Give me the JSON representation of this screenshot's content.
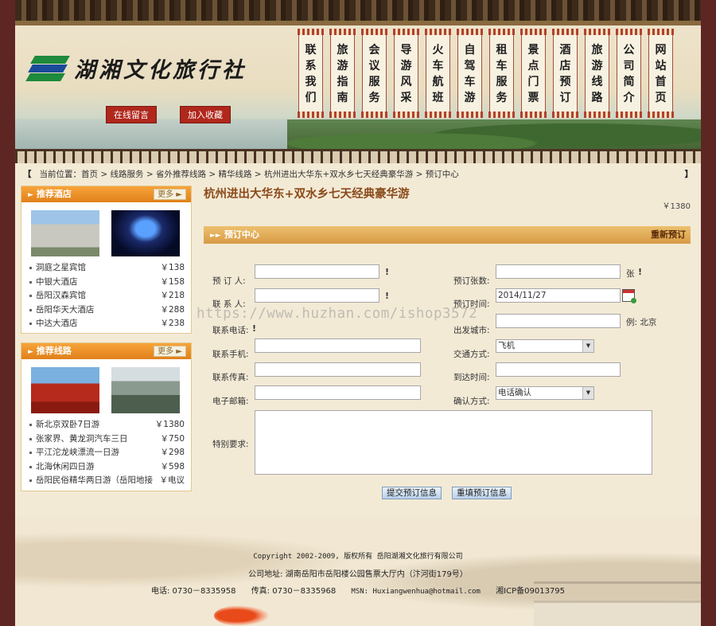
{
  "header": {
    "logo_text": "湖湘文化旅行社",
    "buttons": {
      "message": "在线留言",
      "favorite": "加入收藏"
    },
    "nav": [
      "联系我们",
      "旅游指南",
      "会议服务",
      "导游风采",
      "火车航班",
      "自驾车游",
      "租车服务",
      "景点门票",
      "酒店预订",
      "旅游线路",
      "公司简介",
      "网站首页"
    ]
  },
  "breadcrumb": {
    "prefix": "当前位置：",
    "items": [
      "首页",
      "线路服务",
      "省外推荐线路",
      "精华线路",
      "杭州进出大华东+双水乡七天经典豪华游",
      "预订中心"
    ],
    "sep": " > ",
    "bracket_left": "【",
    "bracket_right": "】"
  },
  "hotels": {
    "title": "推荐酒店",
    "more": "更多",
    "items": [
      {
        "name": "洞庭之星宾馆",
        "price": "￥138"
      },
      {
        "name": "中银大酒店",
        "price": "￥158"
      },
      {
        "name": "岳阳汉森宾馆",
        "price": "￥218"
      },
      {
        "name": "岳阳华天大酒店",
        "price": "￥288"
      },
      {
        "name": "中达大酒店",
        "price": "￥238"
      }
    ]
  },
  "routes": {
    "title": "推荐线路",
    "more": "更多",
    "items": [
      {
        "name": "新北京双卧7日游",
        "price": "￥1380"
      },
      {
        "name": "张家界、黄龙洞汽车三日",
        "price": "￥750"
      },
      {
        "name": "平江沱龙峡漂流一日游",
        "price": "￥298"
      },
      {
        "name": "北海休闲四日游",
        "price": "￥598"
      },
      {
        "name": "岳阳民俗精华两日游（岳阳地接",
        "price": "￥电议"
      }
    ]
  },
  "main": {
    "title": "杭州进出大华东+双水乡七天经典豪华游",
    "price": "￥1380",
    "section_title": "预订中心",
    "reset_link": "重新预订"
  },
  "form": {
    "booker_label": "预 订 人:",
    "booker_value": "",
    "contact_label": "联 系 人:",
    "contact_value": "",
    "phone_label": "联系电话:",
    "mobile_label": "联系手机:",
    "mobile_value": "",
    "fax_label": "联系传真:",
    "fax_value": "",
    "email_label": "电子邮箱:",
    "email_value": "",
    "special_label": "特别要求:",
    "special_value": "",
    "count_label": "预订张数:",
    "count_value": "",
    "count_unit": "张",
    "time_label": "预订时间:",
    "time_value": "2014/11/27",
    "city_label": "出发城市:",
    "city_value": "",
    "city_example": "例: 北京",
    "transport_label": "交通方式:",
    "transport_value": "飞机",
    "arrive_label": "到达时间:",
    "arrive_value": "",
    "confirm_label": "确认方式:",
    "confirm_value": "电话确认",
    "required_mark": "!",
    "submit": "提交预订信息",
    "reset": "重填预订信息"
  },
  "watermark": "https://www.huzhan.com/ishop3572",
  "footer": {
    "copyright": "Copyright 2002-2009, 版权所有 岳阳湖湘文化旅行有限公司",
    "address": "公司地址: 湖南岳阳市岳阳楼公园售票大厅内（汴河街179号）",
    "phone": "电话: 0730－8335958",
    "fax": "传真: 0730－8335968",
    "msn": "MSN: Huxiangwenhua@hotmail.com",
    "icp": "湘ICP备09013795"
  }
}
